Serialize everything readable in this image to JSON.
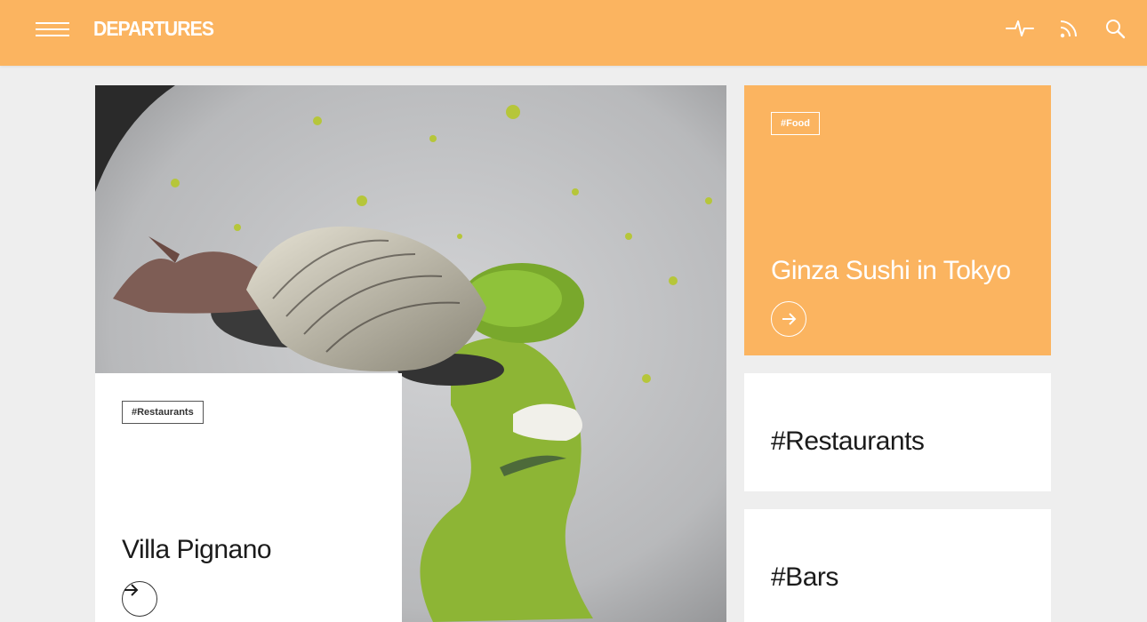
{
  "header": {
    "logo": "DEPARTURES",
    "icons": [
      "menu-icon",
      "activity-pulse-icon",
      "rss-icon",
      "search-icon"
    ]
  },
  "hero": {
    "tag": "#Restaurants",
    "title": "Villa Pignano",
    "image": "plated-dish-photo"
  },
  "food_card": {
    "tag": "#Food",
    "title": "Ginza Sushi in Tokyo"
  },
  "categories": [
    {
      "label": "#Restaurants"
    },
    {
      "label": "#Bars"
    }
  ],
  "colors": {
    "accent": "#fbb460",
    "background": "#eeeeee",
    "card": "#ffffff",
    "text": "#1b1b1b"
  }
}
